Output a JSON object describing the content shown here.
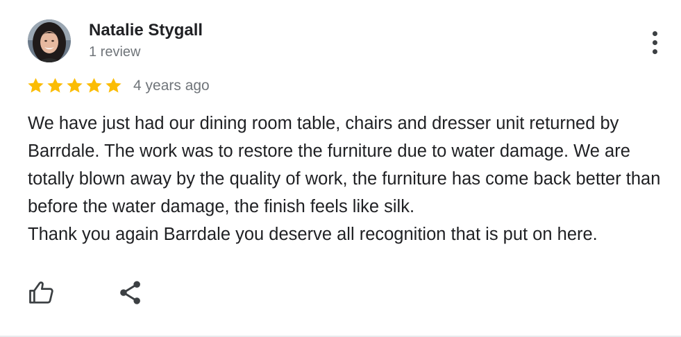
{
  "reviewer": {
    "name": "Natalie Stygall",
    "review_count": "1 review",
    "avatar_icon": "profile-photo"
  },
  "review": {
    "rating": 5,
    "rating_max": 5,
    "star_color": "#fbbc04",
    "date": "4 years ago",
    "paragraphs": [
      "We have just had our dining room table, chairs and dresser unit returned by Barrdale. The work was to restore the furniture due to water damage. We are totally blown away by the quality of work, the furniture has come back better than before the water damage, the finish feels like silk.",
      "Thank you again Barrdale you deserve all recognition that is put on here."
    ]
  },
  "actions": {
    "more_icon": "more-vert-icon",
    "like_icon": "thumbs-up-icon",
    "share_icon": "share-icon"
  },
  "colors": {
    "text_primary": "#202124",
    "text_secondary": "#70757a",
    "icon": "#3c4043"
  }
}
